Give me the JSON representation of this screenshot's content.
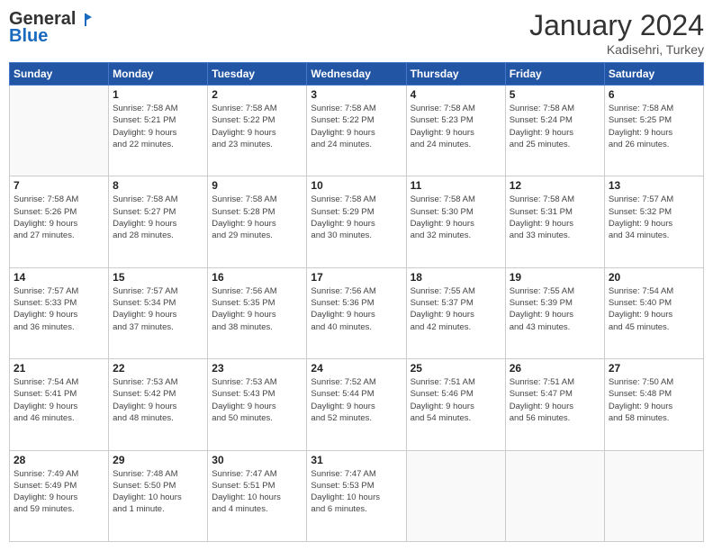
{
  "header": {
    "logo_general": "General",
    "logo_blue": "Blue",
    "month_title": "January 2024",
    "location": "Kadisehri, Turkey"
  },
  "weekdays": [
    "Sunday",
    "Monday",
    "Tuesday",
    "Wednesday",
    "Thursday",
    "Friday",
    "Saturday"
  ],
  "weeks": [
    [
      {
        "day": "",
        "info": ""
      },
      {
        "day": "1",
        "info": "Sunrise: 7:58 AM\nSunset: 5:21 PM\nDaylight: 9 hours\nand 22 minutes."
      },
      {
        "day": "2",
        "info": "Sunrise: 7:58 AM\nSunset: 5:22 PM\nDaylight: 9 hours\nand 23 minutes."
      },
      {
        "day": "3",
        "info": "Sunrise: 7:58 AM\nSunset: 5:22 PM\nDaylight: 9 hours\nand 24 minutes."
      },
      {
        "day": "4",
        "info": "Sunrise: 7:58 AM\nSunset: 5:23 PM\nDaylight: 9 hours\nand 24 minutes."
      },
      {
        "day": "5",
        "info": "Sunrise: 7:58 AM\nSunset: 5:24 PM\nDaylight: 9 hours\nand 25 minutes."
      },
      {
        "day": "6",
        "info": "Sunrise: 7:58 AM\nSunset: 5:25 PM\nDaylight: 9 hours\nand 26 minutes."
      }
    ],
    [
      {
        "day": "7",
        "info": "Sunrise: 7:58 AM\nSunset: 5:26 PM\nDaylight: 9 hours\nand 27 minutes."
      },
      {
        "day": "8",
        "info": "Sunrise: 7:58 AM\nSunset: 5:27 PM\nDaylight: 9 hours\nand 28 minutes."
      },
      {
        "day": "9",
        "info": "Sunrise: 7:58 AM\nSunset: 5:28 PM\nDaylight: 9 hours\nand 29 minutes."
      },
      {
        "day": "10",
        "info": "Sunrise: 7:58 AM\nSunset: 5:29 PM\nDaylight: 9 hours\nand 30 minutes."
      },
      {
        "day": "11",
        "info": "Sunrise: 7:58 AM\nSunset: 5:30 PM\nDaylight: 9 hours\nand 32 minutes."
      },
      {
        "day": "12",
        "info": "Sunrise: 7:58 AM\nSunset: 5:31 PM\nDaylight: 9 hours\nand 33 minutes."
      },
      {
        "day": "13",
        "info": "Sunrise: 7:57 AM\nSunset: 5:32 PM\nDaylight: 9 hours\nand 34 minutes."
      }
    ],
    [
      {
        "day": "14",
        "info": "Sunrise: 7:57 AM\nSunset: 5:33 PM\nDaylight: 9 hours\nand 36 minutes."
      },
      {
        "day": "15",
        "info": "Sunrise: 7:57 AM\nSunset: 5:34 PM\nDaylight: 9 hours\nand 37 minutes."
      },
      {
        "day": "16",
        "info": "Sunrise: 7:56 AM\nSunset: 5:35 PM\nDaylight: 9 hours\nand 38 minutes."
      },
      {
        "day": "17",
        "info": "Sunrise: 7:56 AM\nSunset: 5:36 PM\nDaylight: 9 hours\nand 40 minutes."
      },
      {
        "day": "18",
        "info": "Sunrise: 7:55 AM\nSunset: 5:37 PM\nDaylight: 9 hours\nand 42 minutes."
      },
      {
        "day": "19",
        "info": "Sunrise: 7:55 AM\nSunset: 5:39 PM\nDaylight: 9 hours\nand 43 minutes."
      },
      {
        "day": "20",
        "info": "Sunrise: 7:54 AM\nSunset: 5:40 PM\nDaylight: 9 hours\nand 45 minutes."
      }
    ],
    [
      {
        "day": "21",
        "info": "Sunrise: 7:54 AM\nSunset: 5:41 PM\nDaylight: 9 hours\nand 46 minutes."
      },
      {
        "day": "22",
        "info": "Sunrise: 7:53 AM\nSunset: 5:42 PM\nDaylight: 9 hours\nand 48 minutes."
      },
      {
        "day": "23",
        "info": "Sunrise: 7:53 AM\nSunset: 5:43 PM\nDaylight: 9 hours\nand 50 minutes."
      },
      {
        "day": "24",
        "info": "Sunrise: 7:52 AM\nSunset: 5:44 PM\nDaylight: 9 hours\nand 52 minutes."
      },
      {
        "day": "25",
        "info": "Sunrise: 7:51 AM\nSunset: 5:46 PM\nDaylight: 9 hours\nand 54 minutes."
      },
      {
        "day": "26",
        "info": "Sunrise: 7:51 AM\nSunset: 5:47 PM\nDaylight: 9 hours\nand 56 minutes."
      },
      {
        "day": "27",
        "info": "Sunrise: 7:50 AM\nSunset: 5:48 PM\nDaylight: 9 hours\nand 58 minutes."
      }
    ],
    [
      {
        "day": "28",
        "info": "Sunrise: 7:49 AM\nSunset: 5:49 PM\nDaylight: 9 hours\nand 59 minutes."
      },
      {
        "day": "29",
        "info": "Sunrise: 7:48 AM\nSunset: 5:50 PM\nDaylight: 10 hours\nand 1 minute."
      },
      {
        "day": "30",
        "info": "Sunrise: 7:47 AM\nSunset: 5:51 PM\nDaylight: 10 hours\nand 4 minutes."
      },
      {
        "day": "31",
        "info": "Sunrise: 7:47 AM\nSunset: 5:53 PM\nDaylight: 10 hours\nand 6 minutes."
      },
      {
        "day": "",
        "info": ""
      },
      {
        "day": "",
        "info": ""
      },
      {
        "day": "",
        "info": ""
      }
    ]
  ]
}
